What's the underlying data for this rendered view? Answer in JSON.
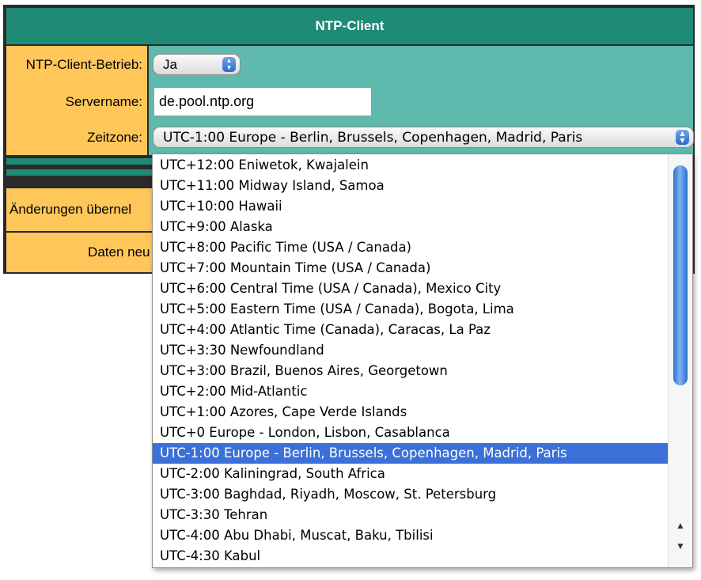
{
  "header": {
    "title": "NTP-Client"
  },
  "rows": {
    "mode": {
      "label": "NTP-Client-Betrieb:",
      "value": "Ja"
    },
    "server": {
      "label": "Servername:",
      "value": "de.pool.ntp.org"
    },
    "timezone": {
      "label": "Zeitzone:",
      "value": "UTC-1:00 Europe - Berlin, Brussels, Copenhagen, Madrid, Paris"
    }
  },
  "actions": {
    "apply_label": "Änderungen übernel",
    "reload_label": "Daten neu l"
  },
  "dropdown": {
    "selected_index": 14,
    "options": [
      "UTC+12:00 Eniwetok, Kwajalein",
      "UTC+11:00 Midway Island, Samoa",
      "UTC+10:00 Hawaii",
      "UTC+9:00 Alaska",
      "UTC+8:00 Pacific Time (USA / Canada)",
      "UTC+7:00 Mountain Time (USA / Canada)",
      "UTC+6:00 Central Time (USA / Canada), Mexico City",
      "UTC+5:00 Eastern Time (USA / Canada), Bogota, Lima",
      "UTC+4:00 Atlantic Time (Canada), Caracas, La Paz",
      "UTC+3:30 Newfoundland",
      "UTC+3:00 Brazil, Buenos Aires, Georgetown",
      "UTC+2:00 Mid-Atlantic",
      "UTC+1:00 Azores, Cape Verde Islands",
      "UTC+0 Europe - London, Lisbon, Casablanca",
      "UTC-1:00 Europe - Berlin, Brussels, Copenhagen, Madrid, Paris",
      "UTC-2:00 Kaliningrad, South Africa",
      "UTC-3:00 Baghdad, Riyadh, Moscow, St. Petersburg",
      "UTC-3:30 Tehran",
      "UTC-4:00 Abu Dhabi, Muscat, Baku, Tbilisi",
      "UTC-4:30 Kabul"
    ]
  },
  "colors": {
    "header": "#1f8a76",
    "label_bg": "#ffc65a",
    "value_bg": "#5fb9ad",
    "selection": "#3a70d8"
  },
  "icons": {
    "popup_arrows": "updown-arrows-icon",
    "scroll_up": "arrow-up-icon",
    "scroll_down": "arrow-down-icon"
  }
}
